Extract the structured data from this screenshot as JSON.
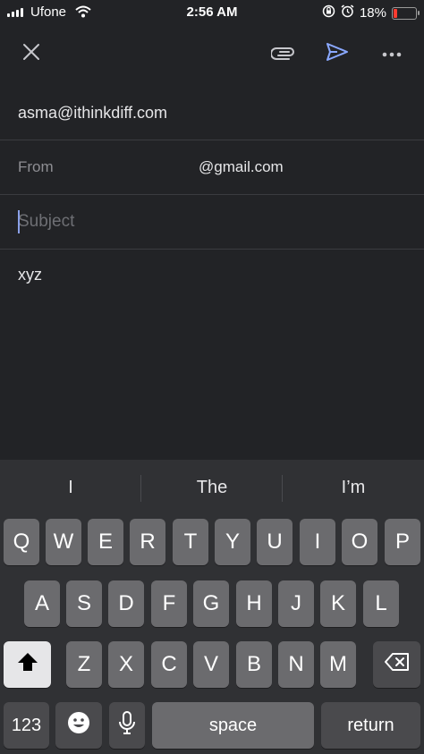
{
  "status_bar": {
    "carrier": "Ufone",
    "time": "2:56 AM",
    "battery_percent": "18%",
    "battery_level": 0.18
  },
  "compose": {
    "to_value": "asma@ithinkdiff.com",
    "from_label": "From",
    "from_value": "@gmail.com",
    "subject_placeholder": "Subject",
    "body_text": "xyz"
  },
  "keyboard": {
    "suggestions": [
      "I",
      "The",
      "I’m"
    ],
    "row1": [
      "Q",
      "W",
      "E",
      "R",
      "T",
      "Y",
      "U",
      "I",
      "O",
      "P"
    ],
    "row2": [
      "A",
      "S",
      "D",
      "F",
      "G",
      "H",
      "J",
      "K",
      "L"
    ],
    "row3": [
      "Z",
      "X",
      "C",
      "V",
      "B",
      "N",
      "M"
    ],
    "numbers_label": "123",
    "space_label": "space",
    "return_label": "return"
  },
  "icons": {
    "close": "close-icon",
    "attach": "paperclip-icon",
    "send": "send-icon",
    "more": "more-icon",
    "emoji": "emoji-icon",
    "mic": "mic-icon",
    "shift": "shift-icon",
    "delete": "backspace-icon"
  },
  "colors": {
    "send_accent": "#8aa8ff",
    "battery_low": "#ff3b30"
  }
}
